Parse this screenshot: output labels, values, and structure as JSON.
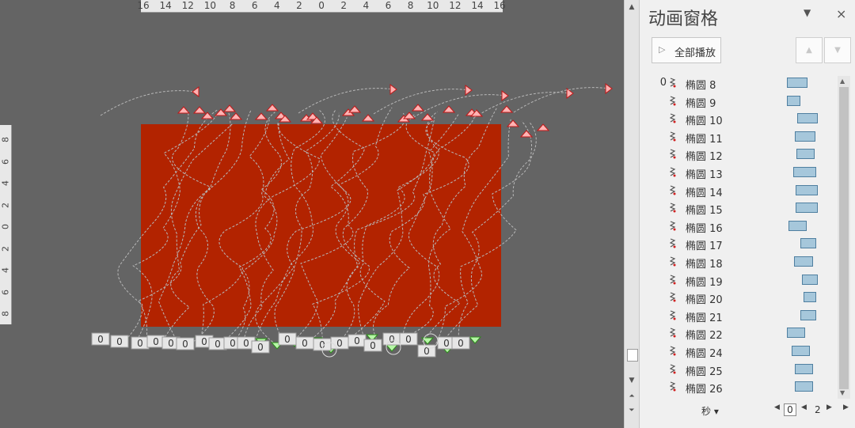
{
  "ruler_top": [
    "16",
    "14",
    "12",
    "10",
    "8",
    "6",
    "4",
    "2",
    "0",
    "2",
    "4",
    "6",
    "8",
    "10",
    "12",
    "14",
    "16"
  ],
  "ruler_left": [
    "8",
    "6",
    "4",
    "2",
    "0",
    "2",
    "4",
    "6",
    "8"
  ],
  "slide": {
    "fill": "#b22300"
  },
  "timing_labels": [
    "0",
    "0",
    "0",
    "0",
    "0",
    "0",
    "0",
    "0",
    "0",
    "0",
    "0",
    "0",
    "0",
    "0",
    "0",
    "0",
    "0",
    "0",
    "0",
    "0",
    "0",
    "0",
    "0",
    "0",
    "0"
  ],
  "pane": {
    "title": "动画窗格",
    "dropdown_icon": "caret-down",
    "close_icon": "×",
    "play_all_label": "全部播放",
    "move_up_icon": "▲",
    "move_down_icon": "▼",
    "items": [
      {
        "num": "0",
        "name": "椭圆 8",
        "bar": [
          0.02,
          0.19
        ]
      },
      {
        "num": "",
        "name": "椭圆 9",
        "bar": [
          0.02,
          0.12
        ]
      },
      {
        "num": "",
        "name": "椭圆 10",
        "bar": [
          0.23,
          0.19
        ]
      },
      {
        "num": "",
        "name": "椭圆 11",
        "bar": [
          0.18,
          0.19
        ]
      },
      {
        "num": "",
        "name": "椭圆 12",
        "bar": [
          0.21,
          0.17
        ]
      },
      {
        "num": "",
        "name": "椭圆 13",
        "bar": [
          0.15,
          0.21
        ]
      },
      {
        "num": "",
        "name": "椭圆 14",
        "bar": [
          0.19,
          0.21
        ]
      },
      {
        "num": "",
        "name": "椭圆 15",
        "bar": [
          0.19,
          0.21
        ]
      },
      {
        "num": "",
        "name": "椭圆 16",
        "bar": [
          0.05,
          0.17
        ]
      },
      {
        "num": "",
        "name": "椭圆 17",
        "bar": [
          0.29,
          0.15
        ]
      },
      {
        "num": "",
        "name": "椭圆 18",
        "bar": [
          0.16,
          0.18
        ]
      },
      {
        "num": "",
        "name": "椭圆 19",
        "bar": [
          0.33,
          0.14
        ]
      },
      {
        "num": "",
        "name": "椭圆 20",
        "bar": [
          0.35,
          0.12
        ]
      },
      {
        "num": "",
        "name": "椭圆 21",
        "bar": [
          0.29,
          0.15
        ]
      },
      {
        "num": "",
        "name": "椭圆 22",
        "bar": [
          0.01,
          0.17
        ]
      },
      {
        "num": "",
        "name": "椭圆 24",
        "bar": [
          0.11,
          0.17
        ]
      },
      {
        "num": "",
        "name": "椭圆 25",
        "bar": [
          0.18,
          0.17
        ]
      },
      {
        "num": "",
        "name": "椭圆 26",
        "bar": [
          0.18,
          0.17
        ]
      }
    ],
    "time_unit": "秒",
    "scale_start": "0",
    "scale_next": "2"
  }
}
